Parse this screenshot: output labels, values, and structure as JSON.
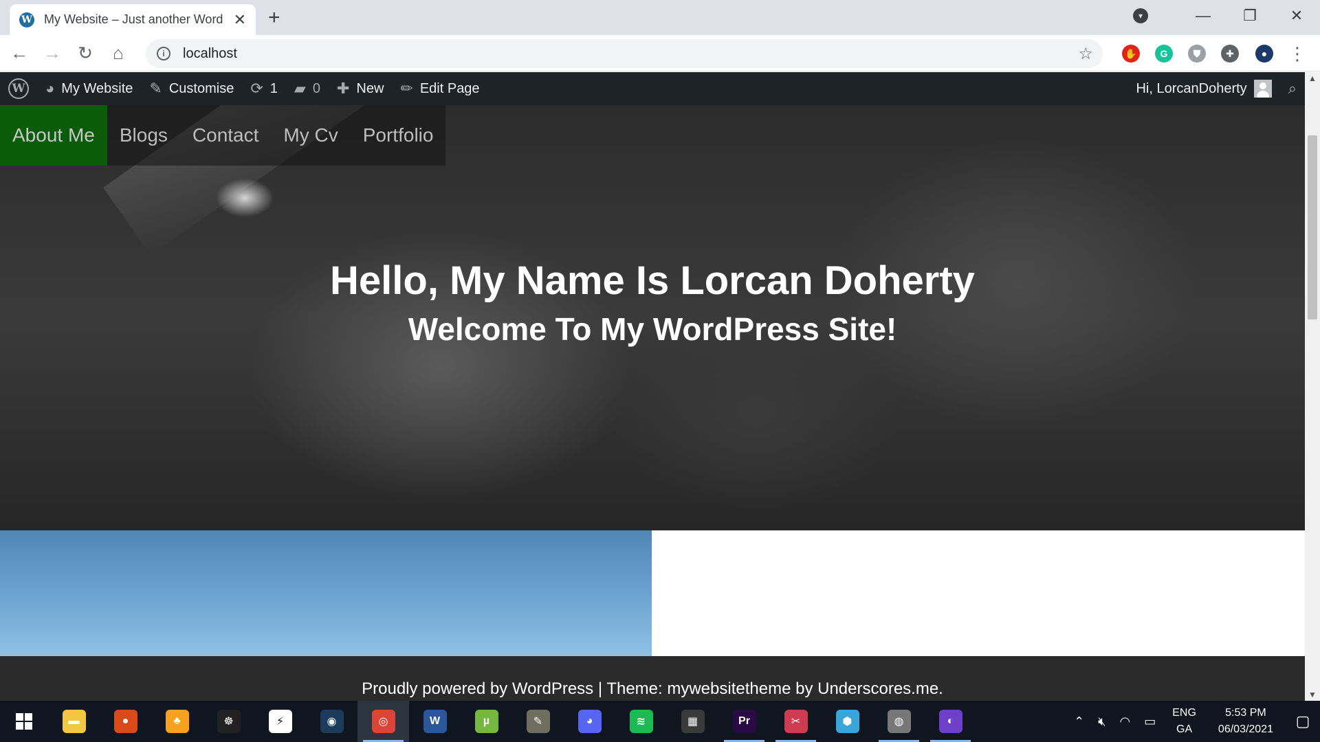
{
  "browser": {
    "tab_title": "My Website – Just another WordPress site",
    "tab_close": "✕",
    "new_tab": "+",
    "url": "localhost",
    "window_controls": {
      "minimize": "—",
      "restore": "❐",
      "close": "✕"
    },
    "extensions": [
      {
        "name": "adblock-icon",
        "glyph": "✋",
        "color": "#e2231a"
      },
      {
        "name": "grammarly-icon",
        "glyph": "G",
        "color": "#15c39a"
      },
      {
        "name": "shield-extension-icon",
        "glyph": "⛊",
        "color": "#9aa0a6"
      },
      {
        "name": "puzzle-icon",
        "glyph": "✚",
        "color": "#5f6368"
      },
      {
        "name": "profile-avatar-icon",
        "glyph": "●",
        "color": "#1b3a6b"
      }
    ]
  },
  "adminbar": {
    "site_name": "My Website",
    "customise": "Customise",
    "updates_count": "1",
    "comments_count": "0",
    "new_label": "New",
    "edit_page": "Edit Page",
    "greeting": "Hi, LorcanDoherty"
  },
  "site": {
    "nav": [
      "About Me",
      "Blogs",
      "Contact",
      "My Cv",
      "Portfolio"
    ],
    "active_nav": "About Me",
    "hero_title": "Hello, My Name Is Lorcan Doherty",
    "hero_subtitle": "Welcome To My WordPress Site!",
    "footer": "Proudly powered by WordPress | Theme: mywebsitetheme by Underscores.me."
  },
  "taskbar": {
    "apps": [
      {
        "name": "file-explorer-icon",
        "glyph": "▬",
        "color": "#f2c744"
      },
      {
        "name": "app-icon-2",
        "glyph": "●",
        "color": "#d94a1a"
      },
      {
        "name": "fl-studio-icon",
        "glyph": "♣",
        "color": "#f6a21e"
      },
      {
        "name": "app-icon-4",
        "glyph": "☸",
        "color": "#222222"
      },
      {
        "name": "app-icon-5",
        "glyph": "⚡",
        "color": "#ffffff"
      },
      {
        "name": "steam-icon",
        "glyph": "◉",
        "color": "#1b3a5c"
      },
      {
        "name": "chrome-icon",
        "glyph": "◎",
        "color": "#db4437"
      },
      {
        "name": "word-icon",
        "glyph": "W",
        "color": "#2b579a"
      },
      {
        "name": "utorrent-icon",
        "glyph": "µ",
        "color": "#76b83f"
      },
      {
        "name": "gimp-icon",
        "glyph": "✎",
        "color": "#6e6e5e"
      },
      {
        "name": "discord-icon",
        "glyph": "◕",
        "color": "#5865f2"
      },
      {
        "name": "spotify-icon",
        "glyph": "≋",
        "color": "#1db954"
      },
      {
        "name": "calculator-icon",
        "glyph": "▦",
        "color": "#3a3a3a"
      },
      {
        "name": "premiere-icon",
        "glyph": "Pr",
        "color": "#2a0a45"
      },
      {
        "name": "snipping-tool-icon",
        "glyph": "✂",
        "color": "#cf3b50"
      },
      {
        "name": "app-icon-16",
        "glyph": "⬢",
        "color": "#3aa5d8"
      },
      {
        "name": "app-icon-17",
        "glyph": "◍",
        "color": "#777777"
      },
      {
        "name": "github-desktop-icon",
        "glyph": "◐",
        "color": "#6e40c9"
      }
    ],
    "running": [
      6,
      13,
      14,
      16,
      17
    ],
    "active": 6,
    "lang_top": "ENG",
    "lang_bottom": "GA",
    "time": "5:53 PM",
    "date": "06/03/2021"
  }
}
